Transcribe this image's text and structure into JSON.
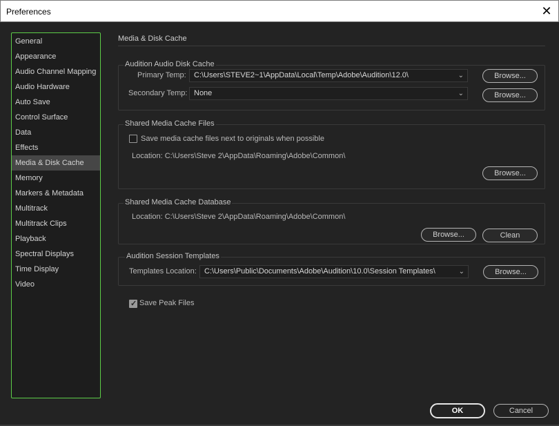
{
  "window": {
    "title": "Preferences",
    "close_glyph": "✕"
  },
  "sidebar": {
    "items": [
      {
        "label": "General"
      },
      {
        "label": "Appearance"
      },
      {
        "label": "Audio Channel Mapping"
      },
      {
        "label": "Audio Hardware"
      },
      {
        "label": "Auto Save"
      },
      {
        "label": "Control Surface"
      },
      {
        "label": "Data"
      },
      {
        "label": "Effects"
      },
      {
        "label": "Media & Disk Cache",
        "selected": true
      },
      {
        "label": "Memory"
      },
      {
        "label": "Markers & Metadata"
      },
      {
        "label": "Multitrack"
      },
      {
        "label": "Multitrack Clips"
      },
      {
        "label": "Playback"
      },
      {
        "label": "Spectral Displays"
      },
      {
        "label": "Time Display"
      },
      {
        "label": "Video"
      }
    ],
    "border_color": "#5dce48"
  },
  "main": {
    "section_title": "Media & Disk Cache",
    "disk_cache": {
      "legend": "Audition Audio Disk Cache",
      "primary_label": "Primary Temp:",
      "primary_value": "C:\\Users\\STEVE2~1\\AppData\\Local\\Temp\\Adobe\\Audition\\12.0\\",
      "secondary_label": "Secondary Temp:",
      "secondary_value": "None",
      "browse_label": "Browse..."
    },
    "shared_files": {
      "legend": "Shared Media Cache Files",
      "checkbox_label": "Save media cache files next to originals when possible",
      "checkbox_checked": false,
      "location_text": "Location: C:\\Users\\Steve 2\\AppData\\Roaming\\Adobe\\Common\\",
      "browse_label": "Browse..."
    },
    "shared_db": {
      "legend": "Shared Media Cache Database",
      "location_text": "Location: C:\\Users\\Steve 2\\AppData\\Roaming\\Adobe\\Common\\",
      "browse_label": "Browse...",
      "clean_label": "Clean"
    },
    "session_templates": {
      "legend": "Audition Session Templates",
      "location_label": "Templates Location:",
      "location_value": "C:\\Users\\Public\\Documents\\Adobe\\Audition\\10.0\\Session Templates\\",
      "browse_label": "Browse..."
    },
    "save_peak": {
      "label": "Save Peak Files",
      "checked": true
    }
  },
  "footer": {
    "ok_label": "OK",
    "cancel_label": "Cancel"
  },
  "icons": {
    "dropdown": "chevron-down-icon",
    "close": "close-icon"
  }
}
